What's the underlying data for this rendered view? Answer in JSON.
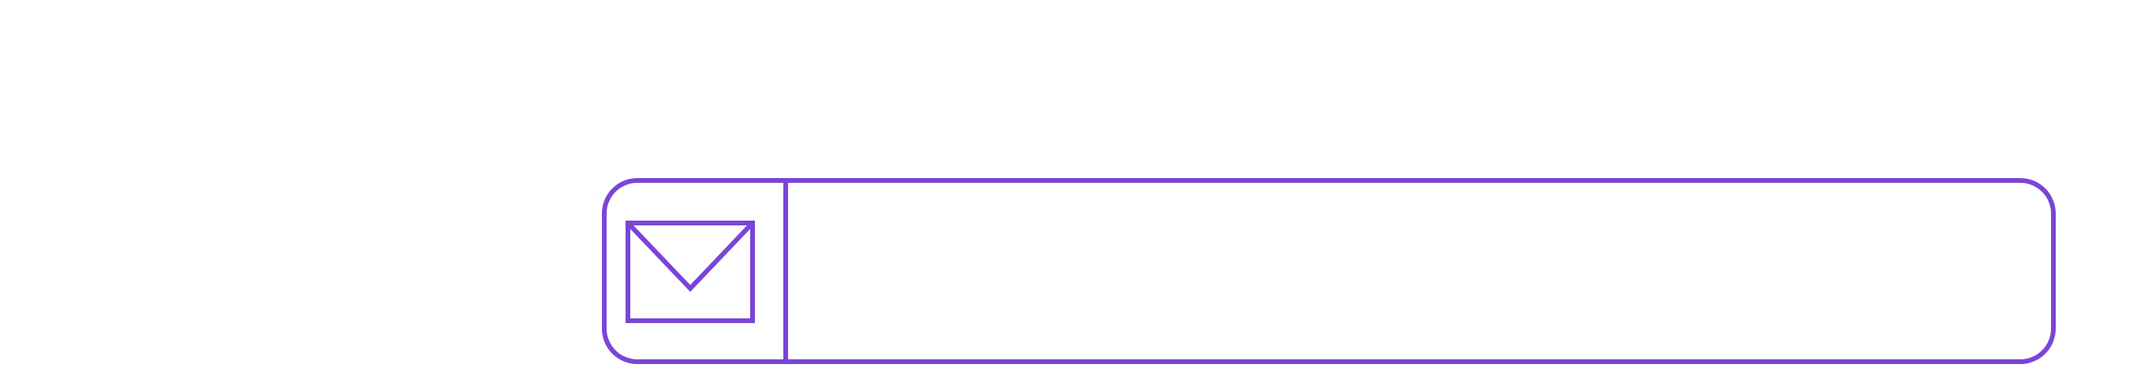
{
  "email_field": {
    "icon": "mail-icon",
    "value": "",
    "placeholder": ""
  },
  "colors": {
    "accent": "#7a45d6",
    "background": "#ffffff"
  }
}
